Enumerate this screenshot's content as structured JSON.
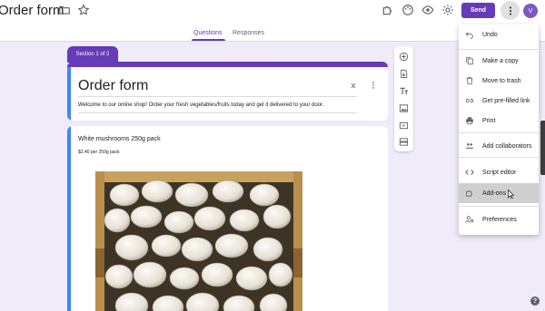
{
  "header": {
    "doc_title": "Order form",
    "icons": [
      "folder-icon",
      "star-icon",
      "addon-puzzle-icon",
      "palette-icon",
      "preview-eye-icon",
      "settings-gear-icon"
    ],
    "send_label": "Send",
    "avatar_letter": "V",
    "tabs": [
      {
        "label": "Questions",
        "active": true
      },
      {
        "label": "Responses",
        "active": false
      }
    ]
  },
  "form": {
    "section_label": "Section 1 of 2",
    "title": "Order form",
    "description": "Welcome to our online shop! Order your fresh vegetables/fruits today and get it delivered to your door."
  },
  "question": {
    "title": "White mushrooms 250g pack",
    "subtitle": "$2.40 per 250g pack"
  },
  "toolbar_icons": [
    "add-question-icon",
    "import-questions-icon",
    "add-title-icon",
    "add-image-icon",
    "add-video-icon",
    "add-section-icon"
  ],
  "menu": {
    "items": [
      {
        "label": "Undo",
        "icon": "undo-icon"
      },
      {
        "label": "Make a copy",
        "icon": "copy-icon"
      },
      {
        "label": "Move to trash",
        "icon": "trash-icon"
      },
      {
        "label": "Get pre-filled link",
        "icon": "link-icon"
      },
      {
        "label": "Print",
        "icon": "print-icon"
      },
      {
        "label": "Add collaborators",
        "icon": "collaborators-icon"
      },
      {
        "label": "Script editor",
        "icon": "code-icon"
      },
      {
        "label": "Add-ons",
        "icon": "addon-puzzle-icon",
        "hovered": true
      },
      {
        "label": "Preferences",
        "icon": "preferences-icon"
      }
    ]
  },
  "colors": {
    "accent": "#673ab7",
    "background": "#f0ebf8",
    "focus_bar": "#4285f4"
  }
}
